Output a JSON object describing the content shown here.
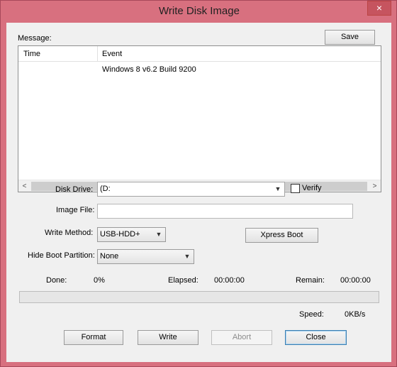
{
  "window": {
    "title": "Write Disk Image",
    "close_glyph": "×"
  },
  "message": {
    "label": "Message:",
    "save_label": "Save"
  },
  "log": {
    "columns": [
      "Time",
      "Event"
    ],
    "rows": [
      {
        "time": "",
        "event": "Windows 8 v6.2 Build 9200"
      }
    ]
  },
  "scroll": {
    "left_arrow": "<",
    "right_arrow": ">"
  },
  "form": {
    "disk_drive_label": "Disk Drive:",
    "disk_drive_value": "(D:",
    "verify_label": "Verify",
    "verify_checked": false,
    "image_file_label": "Image File:",
    "image_file_value": "",
    "write_method_label": "Write Method:",
    "write_method_value": "USB-HDD+",
    "xpress_boot_label": "Xpress Boot",
    "hide_boot_label": "Hide Boot Partition:",
    "hide_boot_value": "None"
  },
  "status": {
    "done_label": "Done:",
    "done_value": "0%",
    "progress": 0,
    "elapsed_label": "Elapsed:",
    "elapsed_value": "00:00:00",
    "remain_label": "Remain:",
    "remain_value": "00:00:00",
    "speed_label": "Speed:",
    "speed_value": "0KB/s"
  },
  "buttons": {
    "format": "Format",
    "write": "Write",
    "abort": "Abort",
    "close": "Close"
  },
  "colors": {
    "title_bar": "#d8707f",
    "progress_fill": "#06b025",
    "close_button": "#c6545f"
  }
}
